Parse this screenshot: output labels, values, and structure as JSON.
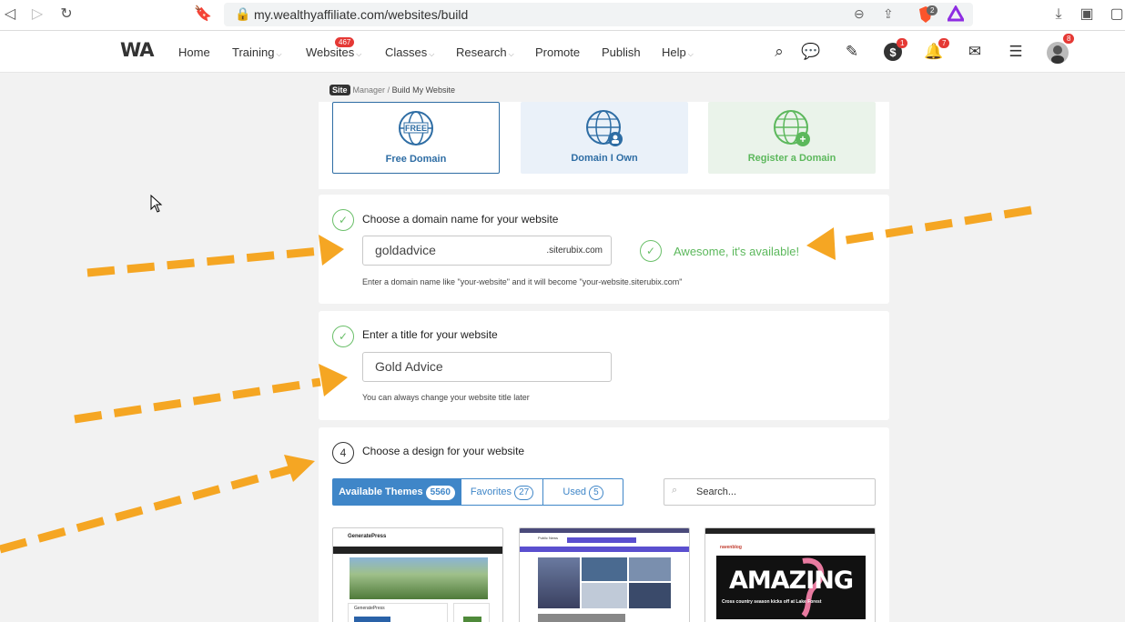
{
  "browser": {
    "url": "my.wealthyaffiliate.com/websites/build",
    "brave_badge": "2"
  },
  "nav": {
    "logo": "WA",
    "items": [
      {
        "label": "Home",
        "dropdown": false
      },
      {
        "label": "Training",
        "dropdown": true
      },
      {
        "label": "Websites",
        "dropdown": true,
        "badge": "467"
      },
      {
        "label": "Classes",
        "dropdown": true
      },
      {
        "label": "Research",
        "dropdown": true
      },
      {
        "label": "Promote",
        "dropdown": false
      },
      {
        "label": "Publish",
        "dropdown": false
      },
      {
        "label": "Help",
        "dropdown": true
      }
    ],
    "dollar_badge": "1",
    "bell_badge": "7",
    "avatar_badge": "8"
  },
  "breadcrumb": {
    "site": "Site",
    "manager": "Manager",
    "separator": "/",
    "current": "Build My Website"
  },
  "domain_options": [
    {
      "label": "Free Domain",
      "icon": "globe-free-icon",
      "color": "#2e6da4"
    },
    {
      "label": "Domain I Own",
      "icon": "globe-user-icon",
      "color": "#2e6da4"
    },
    {
      "label": "Register a Domain",
      "icon": "globe-plus-icon",
      "color": "#5cb85c"
    }
  ],
  "domain_step": {
    "title": "Choose a domain name for your website",
    "value": "goldadvice",
    "suffix": ".siterubix.com",
    "status": "Awesome, it's available!",
    "hint": "Enter a domain name like \"your-website\" and it will become \"your-website.siterubix.com\""
  },
  "title_step": {
    "title": "Enter a title for your website",
    "value": "Gold Advice",
    "hint": "You can always change your website title later"
  },
  "design_step": {
    "number": "4",
    "title": "Choose a design for your website",
    "tabs": [
      {
        "label": "Available Themes",
        "count": "5560"
      },
      {
        "label": "Favorites",
        "count": "27"
      },
      {
        "label": "Used",
        "count": "5"
      }
    ],
    "search_placeholder": "Search...",
    "themes": [
      {
        "name": "GeneratePress",
        "sub": "GeneratePress"
      },
      {
        "name": "Public News",
        "sub": ""
      },
      {
        "name": "ravenblog",
        "headline": "AMAZING",
        "caption": "Cross country season kicks off at Lake Forest"
      }
    ]
  },
  "colors": {
    "accent": "#3f86c8",
    "success": "#5cb85c",
    "arrow": "#f5a623"
  }
}
